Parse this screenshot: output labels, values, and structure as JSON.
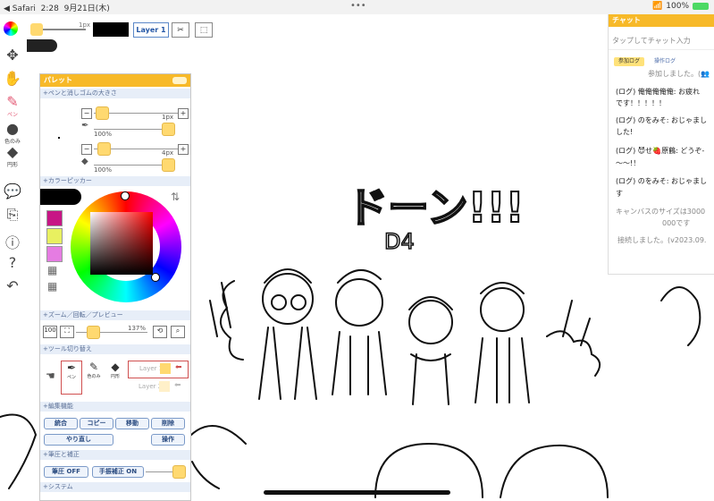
{
  "status_bar": {
    "app": "◀ Safari",
    "time": "2:28",
    "date": "9月21日(木)",
    "dots": "•••",
    "battery": "100%"
  },
  "toolbar": {
    "brush_size": "1px",
    "layer_label": "Layer 1"
  },
  "left_tools": {
    "pen_label": "ペン",
    "color_pick_label": "色のみ",
    "circle_label": "円形"
  },
  "palette": {
    "title": "パレット",
    "pen_eraser_section": "+ペンと消しゴムの大きさ",
    "pen_size": "1px",
    "pen_opacity": "100%",
    "eraser_size": "4px",
    "eraser_opacity": "100%",
    "color_picker_section": "+カラーピッカー",
    "zoom_section": "+ズーム／回転／プレビュー",
    "zoom_value": "100",
    "zoom_percent": "137%",
    "tool_switch_section": "+ツール切り替え",
    "tool_pen_label": "ペン",
    "tool_color_label": "色のみ",
    "tool_circle_label": "円形",
    "layer_1": "Layer 1",
    "layer_2": "Layer 2",
    "edit_section": "+編集機能",
    "merge": "統合",
    "copy": "コピー",
    "move": "移動",
    "delete": "削除",
    "redo": "やり直し",
    "operation": "操作",
    "stroke_section": "+筆圧と補正",
    "pressure_off": "筆圧 OFF",
    "correction_on": "手振補正 ON",
    "system_section": "+システム",
    "colors": {
      "accent": "#f7b928",
      "swatch_1": "#c71585",
      "swatch_2": "#e8f060",
      "swatch_3": "#e57ce2"
    }
  },
  "chat": {
    "title": "チャット",
    "input_placeholder": "タップしてチャット入力",
    "tab_join_log": "参加ログ",
    "tab_operation_log": "操作ログ",
    "messages": [
      {
        "text": "参加しました。(👥"
      },
      {
        "text": "(ログ) 俺俺俺俺俺: お疲れ"
      },
      {
        "text": "です！！！！！"
      },
      {
        "text": "(ログ) のをみそ: おじゃまし"
      },
      {
        "text": "した!"
      },
      {
        "text": "(ログ) 😈せ🍓原鶴: どうぞ-"
      },
      {
        "text": "〜〜!！"
      },
      {
        "text": "(ログ) のをみそ: おじゃまし"
      },
      {
        "text": "す"
      },
      {
        "text": "キャンバスのサイズは3000"
      },
      {
        "text": "000です"
      },
      {
        "text": "接続しました。(v2023.09."
      }
    ]
  },
  "canvas_text": {
    "shout": "ドーン!!!",
    "subtitle": "D4"
  }
}
